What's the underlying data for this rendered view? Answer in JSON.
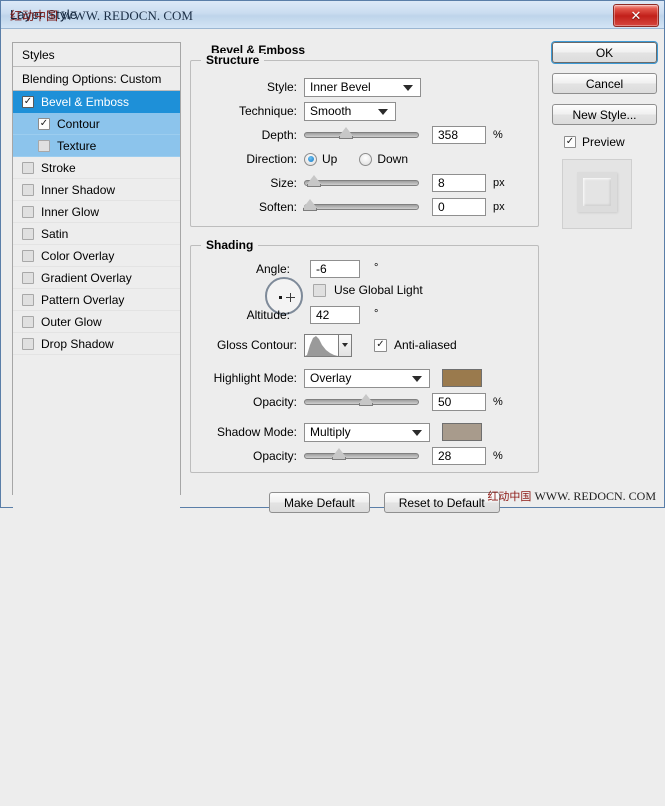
{
  "window": {
    "title": "Layer Style",
    "watermark_cn": "红动中国",
    "watermark_url": "WWW. REDOCN. COM",
    "close_label": "✕"
  },
  "styles_panel": {
    "header": "Styles",
    "blending_options": "Blending Options: Custom",
    "items": [
      {
        "label": "Bevel & Emboss",
        "checked": true,
        "selected": true,
        "sub": false
      },
      {
        "label": "Contour",
        "checked": true,
        "selected": false,
        "sub": true
      },
      {
        "label": "Texture",
        "checked": false,
        "selected": false,
        "sub": true
      },
      {
        "label": "Stroke",
        "checked": false,
        "selected": false,
        "sub": false
      },
      {
        "label": "Inner Shadow",
        "checked": false,
        "selected": false,
        "sub": false
      },
      {
        "label": "Inner Glow",
        "checked": false,
        "selected": false,
        "sub": false
      },
      {
        "label": "Satin",
        "checked": false,
        "selected": false,
        "sub": false
      },
      {
        "label": "Color Overlay",
        "checked": false,
        "selected": false,
        "sub": false
      },
      {
        "label": "Gradient Overlay",
        "checked": false,
        "selected": false,
        "sub": false
      },
      {
        "label": "Pattern Overlay",
        "checked": false,
        "selected": false,
        "sub": false
      },
      {
        "label": "Outer Glow",
        "checked": false,
        "selected": false,
        "sub": false
      },
      {
        "label": "Drop Shadow",
        "checked": false,
        "selected": false,
        "sub": false
      }
    ],
    "check_glyph": "✓"
  },
  "main": {
    "title": "Bevel & Emboss",
    "structure": {
      "legend": "Structure",
      "style_label": "Style:",
      "style_value": "Inner Bevel",
      "technique_label": "Technique:",
      "technique_value": "Smooth",
      "depth_label": "Depth:",
      "depth_value": "358",
      "depth_unit": "%",
      "depth_percent": 30,
      "direction_label": "Direction:",
      "direction_up": "Up",
      "direction_down": "Down",
      "direction_selected": "Up",
      "size_label": "Size:",
      "size_value": "8",
      "size_unit": "px",
      "size_percent": 4,
      "soften_label": "Soften:",
      "soften_value": "0",
      "soften_unit": "px",
      "soften_percent": 0
    },
    "shading": {
      "legend": "Shading",
      "angle_label": "Angle:",
      "angle_value": "-6",
      "angle_unit": "°",
      "altitude_label": "Altitude:",
      "altitude_value": "42",
      "altitude_unit": "°",
      "use_global_light": "Use Global Light",
      "use_global_light_checked": false,
      "gloss_contour_label": "Gloss Contour:",
      "anti_aliased": "Anti-aliased",
      "anti_aliased_checked": true,
      "highlight_mode_label": "Highlight Mode:",
      "highlight_mode_value": "Overlay",
      "highlight_color": "#9a7a4d",
      "highlight_opacity_label": "Opacity:",
      "highlight_opacity_value": "50",
      "highlight_opacity_unit": "%",
      "highlight_opacity_percent": 50,
      "shadow_mode_label": "Shadow Mode:",
      "shadow_mode_value": "Multiply",
      "shadow_color": "#a89b8c",
      "shadow_opacity_label": "Opacity:",
      "shadow_opacity_value": "28",
      "shadow_opacity_unit": "%",
      "shadow_opacity_percent": 28
    }
  },
  "buttons": {
    "ok": "OK",
    "cancel": "Cancel",
    "new_style": "New Style...",
    "preview": "Preview",
    "preview_checked": true,
    "make_default": "Make Default",
    "reset_to_default": "Reset to Default"
  }
}
